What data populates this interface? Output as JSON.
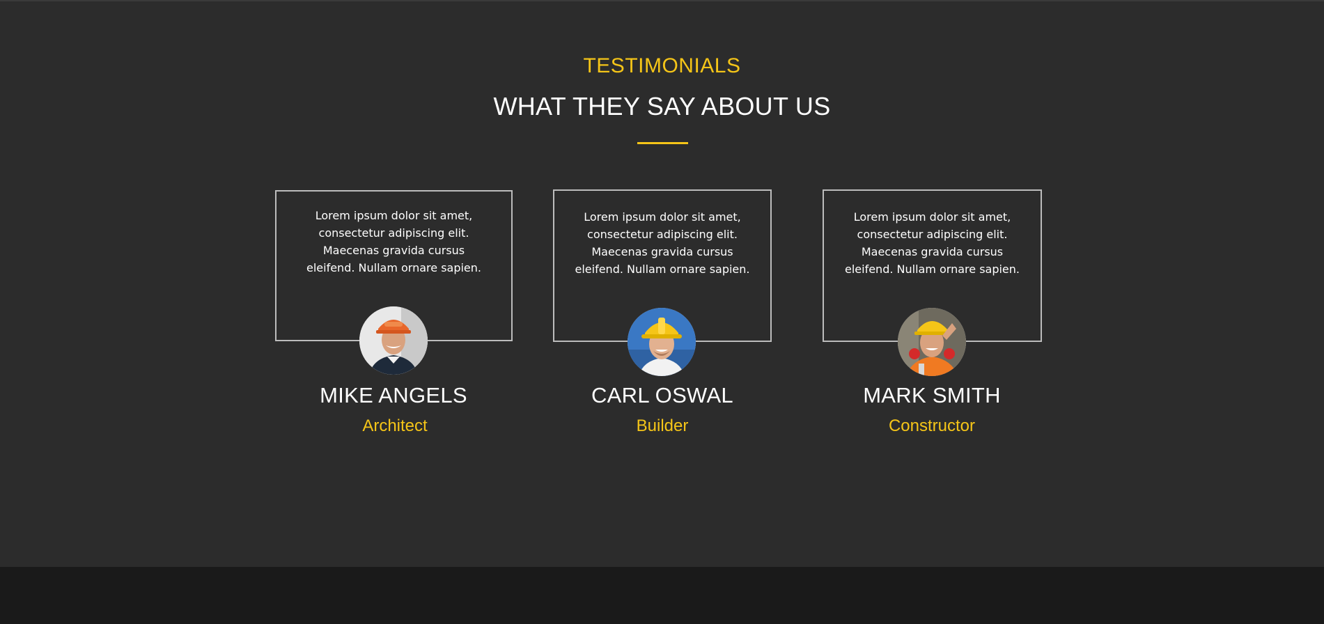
{
  "section": {
    "kicker": "TESTIMONIALS",
    "heading": "WHAT THEY SAY ABOUT US"
  },
  "colors": {
    "accent": "#f5c518",
    "background": "#2c2c2c",
    "footer": "#1a1a1a",
    "card_border": "#bdbdbd",
    "text": "#ffffff"
  },
  "testimonials": [
    {
      "quote": "Lorem ipsum dolor sit amet, consectetur adipiscing elit. Maecenas gravida cursus eleifend. Nullam ornare sapien.",
      "name": "MIKE ANGELS",
      "role": "Architect",
      "avatar_icon": "worker-orange-hardhat-photo"
    },
    {
      "quote": "Lorem ipsum dolor sit amet, consectetur adipiscing elit. Maecenas gravida cursus eleifend. Nullam ornare sapien.",
      "name": "CARL OSWAL",
      "role": "Builder",
      "avatar_icon": "worker-yellow-hardhat-photo"
    },
    {
      "quote": "Lorem ipsum dolor sit amet, consectetur adipiscing elit. Maecenas gravida cursus eleifend. Nullam ornare sapien.",
      "name": "MARK SMITH",
      "role": "Constructor",
      "avatar_icon": "worker-yellow-hardhat-earmuffs-photo"
    }
  ]
}
